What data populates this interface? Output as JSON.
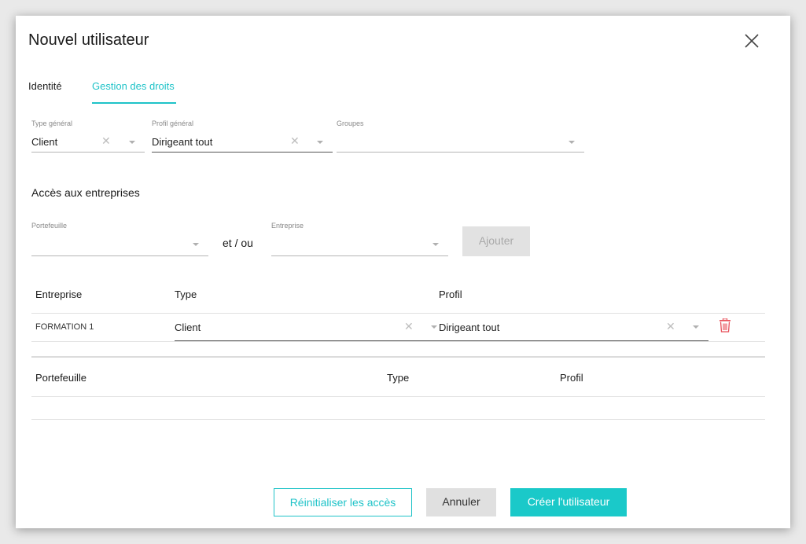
{
  "modal": {
    "title": "Nouvel utilisateur",
    "tabs": [
      {
        "label": "Identité",
        "active": false
      },
      {
        "label": "Gestion des droits",
        "active": true
      }
    ]
  },
  "general": {
    "type": {
      "label": "Type général",
      "value": "Client"
    },
    "profile": {
      "label": "Profil général",
      "value": "Dirigeant tout"
    },
    "groups": {
      "label": "Groupes",
      "value": ""
    }
  },
  "access": {
    "title": "Accès aux entreprises",
    "portfolio_label": "Portefeuille",
    "connector": "et / ou",
    "company_label": "Entreprise",
    "add_button": "Ajouter"
  },
  "companies_table": {
    "headers": [
      "Entreprise",
      "Type",
      "Profil"
    ],
    "rows": [
      {
        "company": "FORMATION 1",
        "type": "Client",
        "profile": "Dirigeant tout"
      }
    ]
  },
  "portfolio_table": {
    "headers": [
      "Portefeuille",
      "Type",
      "Profil"
    ],
    "rows": []
  },
  "footer": {
    "reset": "Réinitialiser les accès",
    "cancel": "Annuler",
    "create": "Créer l'utilisateur"
  },
  "colors": {
    "accent": "#1fc3c8",
    "danger": "#e8505b",
    "disabled_bg": "#e2e2e2"
  }
}
